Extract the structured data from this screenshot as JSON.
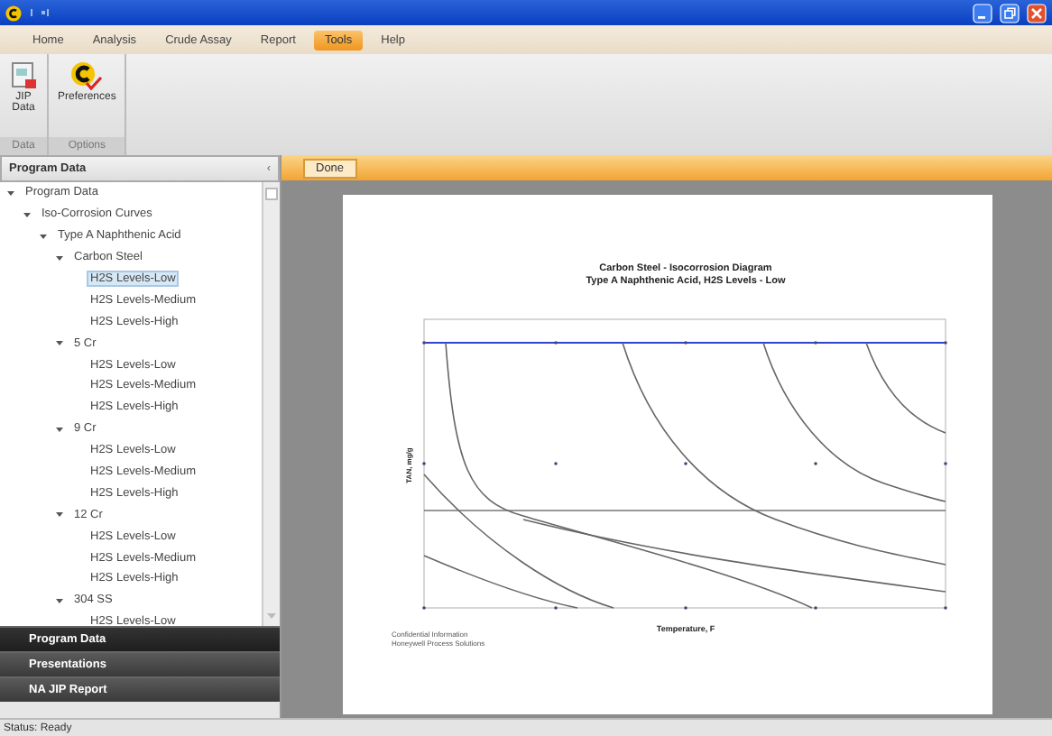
{
  "menu": [
    {
      "label": "Home",
      "selected": false
    },
    {
      "label": "Analysis",
      "selected": false
    },
    {
      "label": "Crude Assay",
      "selected": false
    },
    {
      "label": "Report",
      "selected": false
    },
    {
      "label": "Tools",
      "selected": true
    },
    {
      "label": "Help",
      "selected": false
    }
  ],
  "ribbon": {
    "groups": [
      {
        "label": "Data",
        "buttons": [
          {
            "label": "JIP Data",
            "kind": "jip"
          }
        ]
      },
      {
        "label": "Options",
        "buttons": [
          {
            "label": "Preferences",
            "kind": "prefs"
          }
        ]
      }
    ]
  },
  "left_panel": {
    "title": "Program Data",
    "collapse": "‹",
    "tree": [
      {
        "label": "Program Data",
        "expanded": true,
        "selected": false,
        "children": [
          {
            "label": "Iso-Corrosion Curves",
            "expanded": true,
            "selected": false,
            "children": [
              {
                "label": "Type A Naphthenic Acid",
                "expanded": true,
                "selected": false,
                "children": [
                  {
                    "label": "Carbon Steel",
                    "expanded": true,
                    "selected": false,
                    "children": [
                      {
                        "label": "H2S Levels-Low",
                        "selected": true
                      },
                      {
                        "label": "H2S Levels-Medium",
                        "selected": false
                      },
                      {
                        "label": "H2S Levels-High",
                        "selected": false
                      }
                    ]
                  },
                  {
                    "label": "5 Cr",
                    "expanded": true,
                    "selected": false,
                    "children": [
                      {
                        "label": "H2S Levels-Low",
                        "selected": false
                      },
                      {
                        "label": "H2S Levels-Medium",
                        "selected": false
                      },
                      {
                        "label": "H2S Levels-High",
                        "selected": false
                      }
                    ]
                  },
                  {
                    "label": "9 Cr",
                    "expanded": true,
                    "selected": false,
                    "children": [
                      {
                        "label": "H2S Levels-Low",
                        "selected": false
                      },
                      {
                        "label": "H2S Levels-Medium",
                        "selected": false
                      },
                      {
                        "label": "H2S Levels-High",
                        "selected": false
                      }
                    ]
                  },
                  {
                    "label": "12 Cr",
                    "expanded": true,
                    "selected": false,
                    "children": [
                      {
                        "label": "H2S Levels-Low",
                        "selected": false
                      },
                      {
                        "label": "H2S Levels-Medium",
                        "selected": false
                      },
                      {
                        "label": "H2S Levels-High",
                        "selected": false
                      }
                    ]
                  },
                  {
                    "label": "304 SS",
                    "expanded": true,
                    "selected": false,
                    "children": [
                      {
                        "label": "H2S Levels-Low",
                        "selected": false
                      }
                    ]
                  }
                ]
              }
            ]
          }
        ]
      }
    ],
    "nav": [
      {
        "label": "Program Data",
        "selected": true
      },
      {
        "label": "Presentations",
        "selected": false
      },
      {
        "label": "NA JIP Report",
        "selected": false
      }
    ]
  },
  "toolbar": {
    "done": "Done"
  },
  "document": {
    "title": "Carbon Steel - Isocorrosion Diagram",
    "subtitle": "Type A Naphthenic Acid, H2S Levels - Low",
    "ylabel": "TAN, mg/g",
    "xlabel": "Temperature, F",
    "footnote": [
      "Confidential Information",
      "Honeywell Process Solutions"
    ]
  },
  "status_bar": "Status: Ready"
}
